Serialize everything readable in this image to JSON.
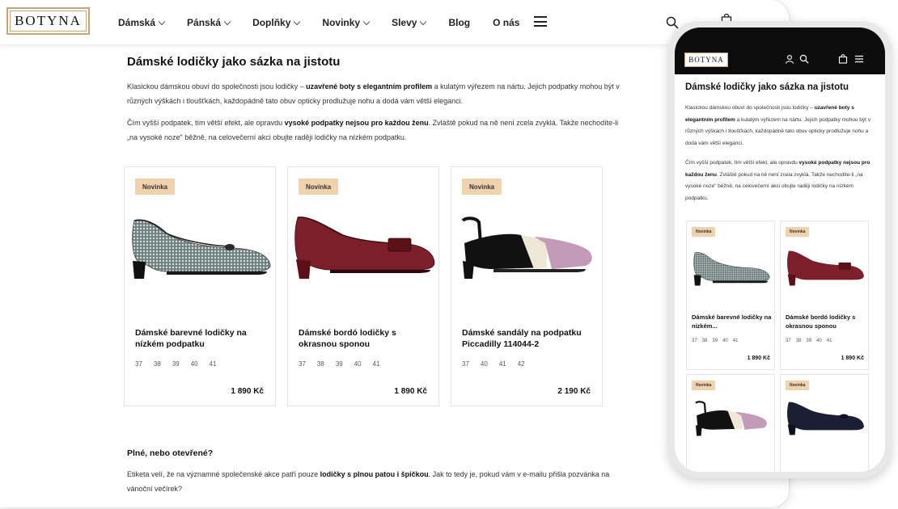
{
  "brand": {
    "logo_text": "BOTYNA"
  },
  "nav": {
    "items": [
      {
        "label": "Dámská",
        "has_dropdown": true
      },
      {
        "label": "Pánská",
        "has_dropdown": true
      },
      {
        "label": "Doplňky",
        "has_dropdown": true
      },
      {
        "label": "Novinky",
        "has_dropdown": true
      },
      {
        "label": "Slevy",
        "has_dropdown": true
      },
      {
        "label": "Blog",
        "has_dropdown": false
      },
      {
        "label": "O nás",
        "has_dropdown": false
      }
    ],
    "icons": [
      "hamburger-icon",
      "search-icon",
      "shopping-bag-icon"
    ]
  },
  "article": {
    "title": "Dámské lodičky jako sázka na jistotu",
    "p1_a": "Klasickou dámskou obuví do společnosti jsou lodičky – ",
    "p1_b": "uzavřené boty s elegantním profilem",
    "p1_c": " a kulatým výřezem na nártu. Jejich podpatky mohou být v různých výškách i tloušťkách, každopádně tato obuv opticky prodlužuje nohu a dodá vám větší eleganci.",
    "p2_a": "Čím vyšší podpatek, tím větší efekt, ale opravdu ",
    "p2_b": "vysoké podpatky nejsou pro každou ženu",
    "p2_c": ". Zvláště pokud na ně není zcela zvyklá. Takže nechodíte-li „na vysoké noze\" běžně, na celovečerní akci obujte raději lodičky na nízkém podpatku.",
    "subtitle": "Plné, nebo otevřené?",
    "p3_a": "Etiketa velí, že na významné společenské akce patří pouze ",
    "p3_b": "lodičky s plnou patou i špičkou",
    "p3_c": ". Jak to tedy je, pokud vám v e-mailu přišla pozvánka na vánoční večírek?"
  },
  "products": [
    {
      "badge": "Novinka",
      "title": "Dámské barevné lodičky na nízkém podpatku",
      "sizes": [
        "37",
        "38",
        "39",
        "40",
        "41"
      ],
      "price": "1 890 Kč"
    },
    {
      "badge": "Novinka",
      "title": "Dámské bordó lodičky s okrasnou sponou",
      "sizes": [
        "37",
        "38",
        "39",
        "40",
        "41"
      ],
      "price": "1 890 Kč"
    },
    {
      "badge": "Novinka",
      "title": "Dámské sandály na podpatku Piccadilly 114044-2",
      "sizes": [
        "37",
        "40",
        "41",
        "42"
      ],
      "price": "2 190 Kč"
    }
  ],
  "mobile": {
    "logo_text": "BOTYNA",
    "title": "Dámské lodičky jako sázka na jistotu",
    "products": [
      {
        "badge": "Novinka",
        "title": "Dámské barevné lodičky na nízkém...",
        "sizes": [
          "37",
          "38",
          "39",
          "40",
          "41"
        ],
        "price": "1 890 Kč"
      },
      {
        "badge": "Novinka",
        "title": "Dámské bordó lodičky s okrasnou sponou",
        "sizes": [
          "37",
          "38",
          "39",
          "40",
          "41"
        ],
        "price": "1 890 Kč"
      },
      {
        "badge": "Novinka"
      },
      {
        "badge": "Novinka"
      }
    ]
  },
  "colors": {
    "badge_bg": "#f0d2ac",
    "logo_border": "#c7a47a",
    "mobile_header": "#0c0c0c"
  }
}
